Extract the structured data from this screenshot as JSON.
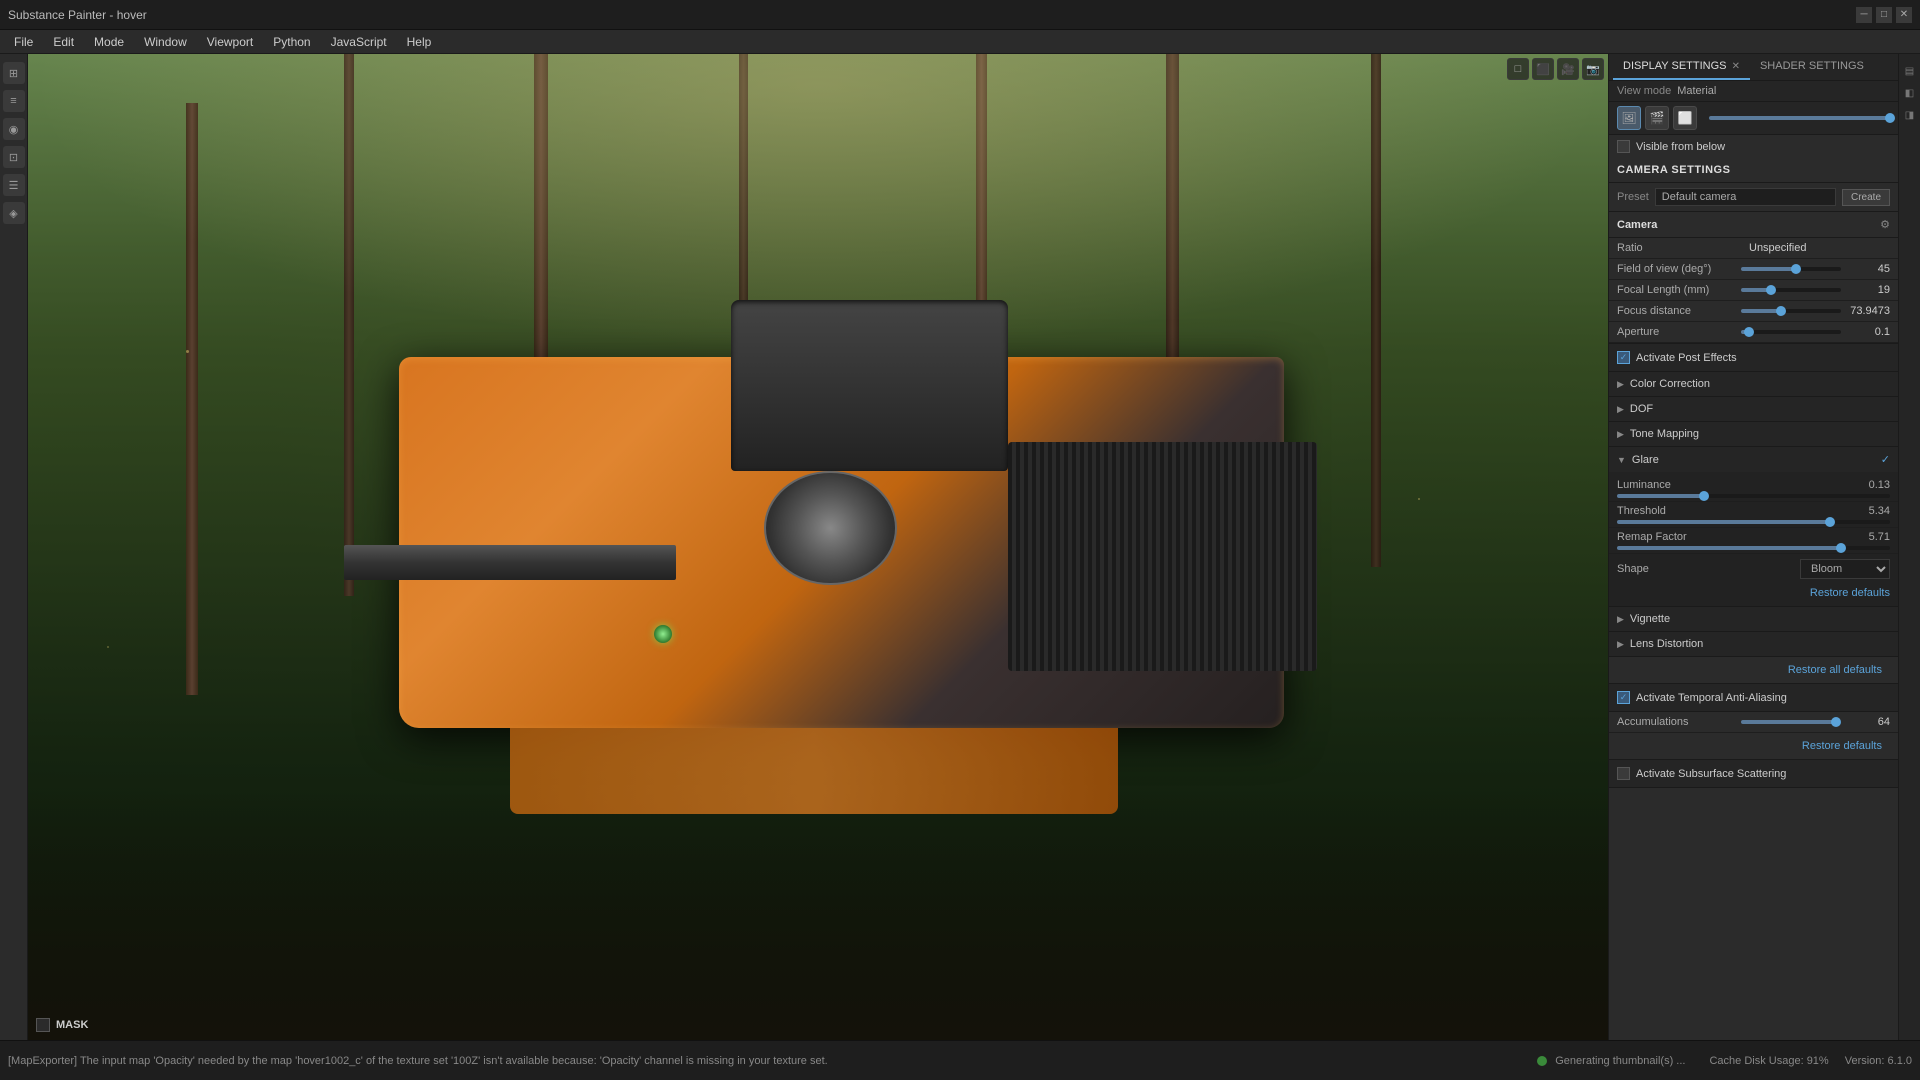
{
  "app": {
    "title": "Substance Painter - hover"
  },
  "window_controls": {
    "minimize": "─",
    "maximize": "□",
    "close": "✕"
  },
  "menubar": {
    "items": [
      "File",
      "Edit",
      "Mode",
      "Window",
      "Viewport",
      "Python",
      "JavaScript",
      "Help"
    ]
  },
  "left_sidebar": {
    "icons": [
      "⊞",
      "≡",
      "◉",
      "⊡",
      "☰",
      "◈"
    ]
  },
  "viewport": {
    "mask_label": "MASK"
  },
  "viewport_toolbar": {
    "icons": [
      "□",
      "🎥",
      "💡",
      "📷"
    ]
  },
  "right_panel": {
    "tabs": [
      {
        "label": "DISPLAY SETTINGS",
        "active": true
      },
      {
        "label": "SHADER SETTINGS",
        "active": false
      }
    ]
  },
  "display_settings": {
    "view_mode_label": "View mode",
    "view_mode_value": "Material",
    "visible_from_below_label": "Visible from below",
    "camera_settings_label": "CAMERA SETTINGS",
    "preset_label": "Preset",
    "preset_value": "Default camera",
    "preset_button": "Create",
    "camera": {
      "title": "Camera",
      "ratio_label": "Ratio",
      "ratio_value": "Unspecified",
      "fov_label": "Field of view (deg°)",
      "fov_value": "45",
      "fov_percent": 55,
      "focal_label": "Focal Length (mm)",
      "focal_value": "19",
      "focal_percent": 30,
      "focus_label": "Focus distance",
      "focus_value": "73.9473",
      "focus_percent": 40,
      "aperture_label": "Aperture",
      "aperture_value": "0.1",
      "aperture_percent": 8
    },
    "activate_post_effects_label": "Activate Post Effects",
    "activate_post_effects_checked": true,
    "post_effects": [
      {
        "label": "Color Correction",
        "expanded": false
      },
      {
        "label": "DOF",
        "expanded": false
      },
      {
        "label": "Tone Mapping",
        "expanded": false
      }
    ],
    "glare": {
      "label": "Glare",
      "expanded": true,
      "checked": true,
      "luminance_label": "Luminance",
      "luminance_value": "0.13",
      "luminance_percent": 32,
      "threshold_label": "Threshold",
      "threshold_value": "5.34",
      "threshold_percent": 78,
      "remap_label": "Remap Factor",
      "remap_value": "5.71",
      "remap_percent": 82,
      "shape_label": "Shape",
      "shape_value": "Bloom",
      "restore_label": "Restore defaults"
    },
    "vignette_label": "Vignette",
    "lens_distortion_label": "Lens Distortion",
    "restore_all_label": "Restore all defaults",
    "activate_taa_label": "Activate Temporal Anti-Aliasing",
    "activate_taa_checked": true,
    "accumulations_label": "Accumulations",
    "accumulations_value": "64",
    "accumulations_percent": 95,
    "restore_taa_label": "Restore defaults",
    "activate_sss_label": "Activate Subsurface Scattering"
  },
  "statusbar": {
    "left_text": "[MapExporter] The input map 'Opacity' needed by the map 'hover1002_c' of the texture set '100Z' isn't available because: 'Opacity' channel is missing in your texture set.",
    "generating_label": "Generating thumbnail(s) ...",
    "cache_label": "Cache Disk Usage: 91%",
    "version_label": "Version: 6.1.0"
  },
  "colors": {
    "accent": "#5ba3d9",
    "accent_green": "#3a8a3a",
    "bg_dark": "#1e1e1e",
    "bg_medium": "#2b2b2b",
    "bg_light": "#3a3a3a",
    "text_primary": "#ccc",
    "text_secondary": "#aaa",
    "text_muted": "#888"
  }
}
